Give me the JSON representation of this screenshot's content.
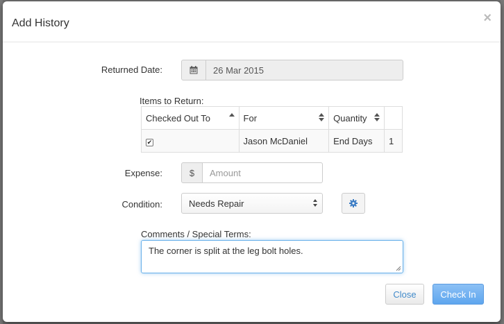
{
  "modal": {
    "title": "Add History",
    "close_glyph": "×"
  },
  "returned_date": {
    "label": "Returned Date:",
    "icon": "calendar-icon",
    "value": "26 Mar 2015"
  },
  "items": {
    "label": "Items to Return:",
    "columns": [
      "Checked Out To",
      "For",
      "Quantity",
      ""
    ],
    "rows": [
      {
        "checked": true,
        "checked_out_to": "",
        "for": "Jason McDaniel",
        "quantity": "End Days",
        "extra": "1"
      }
    ]
  },
  "expense": {
    "label": "Expense:",
    "prefix": "$",
    "placeholder": "Amount"
  },
  "condition": {
    "label": "Condition:",
    "selected": "Needs Repair",
    "settings_icon": "gear-icon"
  },
  "comments": {
    "label": "Comments / Special Terms:",
    "value": "The corner is split at the leg bolt holes."
  },
  "buttons": {
    "close": "Close",
    "check_in": "Check In"
  },
  "colors": {
    "primary": "#5ea6ee",
    "link": "#428bca",
    "gear": "#3a7cc4"
  }
}
